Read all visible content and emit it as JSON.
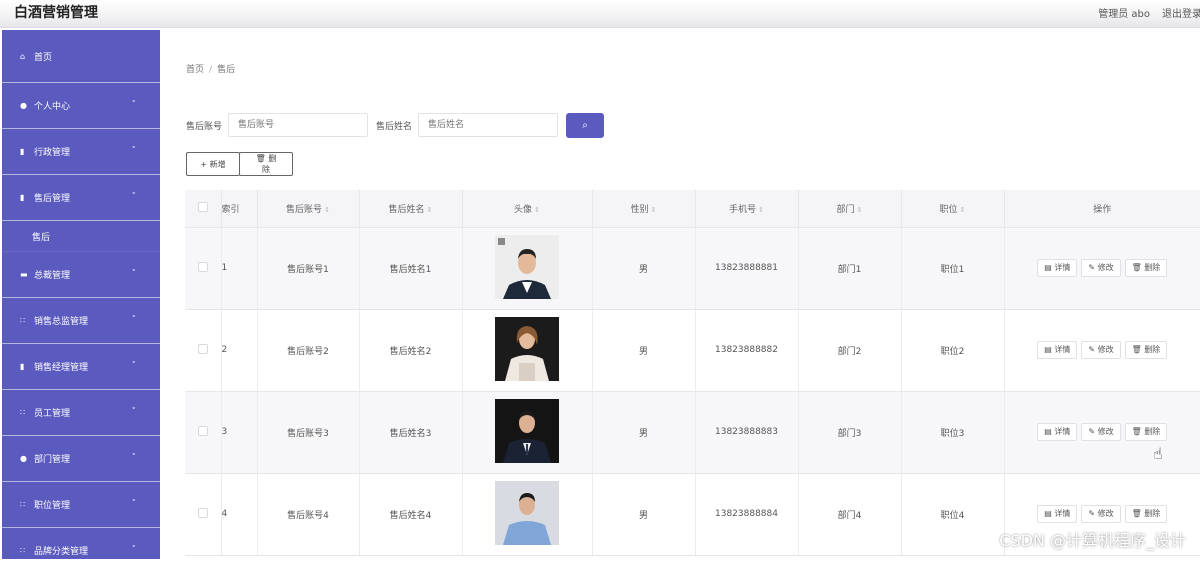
{
  "header": {
    "app_title": "白酒营销管理",
    "user": "管理员 abo",
    "logout": "退出登录"
  },
  "sidebar": {
    "items": [
      {
        "label": "首页",
        "icon": "home-icon",
        "glyph": "⌂",
        "chevron": false
      },
      {
        "label": "个人中心",
        "icon": "user-icon",
        "glyph": "●",
        "chevron": true
      },
      {
        "label": "行政管理",
        "icon": "doc-icon",
        "glyph": "▮",
        "chevron": true
      },
      {
        "label": "售后管理",
        "icon": "doc-icon",
        "glyph": "▮",
        "chevron": true,
        "sub": "售后"
      },
      {
        "label": "总裁管理",
        "icon": "message-icon",
        "glyph": "▬",
        "chevron": true
      },
      {
        "label": "销售总监管理",
        "icon": "grid-icon",
        "glyph": "∷",
        "chevron": true
      },
      {
        "label": "销售经理管理",
        "icon": "doc-icon",
        "glyph": "▮",
        "chevron": true
      },
      {
        "label": "员工管理",
        "icon": "grid-icon",
        "glyph": "∷",
        "chevron": true
      },
      {
        "label": "部门管理",
        "icon": "user-icon",
        "glyph": "●",
        "chevron": true
      },
      {
        "label": "职位管理",
        "icon": "grid-icon",
        "glyph": "∷",
        "chevron": true
      },
      {
        "label": "品牌分类管理",
        "icon": "grid-icon",
        "glyph": "∷",
        "chevron": true
      }
    ],
    "chevron_glyph": "˅"
  },
  "breadcrumb": {
    "home": "首页",
    "sep": "/",
    "current": "售后"
  },
  "search": {
    "account_label": "售后账号",
    "account_placeholder": "售后账号",
    "name_label": "售后姓名",
    "name_placeholder": "售后姓名",
    "button_glyph": "⌕"
  },
  "actions": {
    "add": "+ 新增",
    "delete": "🗑 删除"
  },
  "table": {
    "headers": [
      "索引",
      "售后账号",
      "售后姓名",
      "头像",
      "性别",
      "手机号",
      "部门",
      "职位",
      "操作"
    ],
    "sort_glyph": "⇕",
    "rows": [
      {
        "index": "1",
        "account": "售后账号1",
        "name": "售后姓名1",
        "gender": "男",
        "phone": "13823888881",
        "dept": "部门1",
        "position": "职位1"
      },
      {
        "index": "2",
        "account": "售后账号2",
        "name": "售后姓名2",
        "gender": "男",
        "phone": "13823888882",
        "dept": "部门2",
        "position": "职位2"
      },
      {
        "index": "3",
        "account": "售后账号3",
        "name": "售后姓名3",
        "gender": "男",
        "phone": "13823888883",
        "dept": "部门3",
        "position": "职位3"
      },
      {
        "index": "4",
        "account": "售后账号4",
        "name": "售后姓名4",
        "gender": "男",
        "phone": "13823888884",
        "dept": "部门4",
        "position": "职位4"
      }
    ],
    "op_detail": "▤ 详情",
    "op_edit": "✎ 修改",
    "op_delete": "🗑 删除"
  },
  "watermark": "CSDN @计算机程序_设计",
  "colors": {
    "primary": "#5b5bbf"
  }
}
